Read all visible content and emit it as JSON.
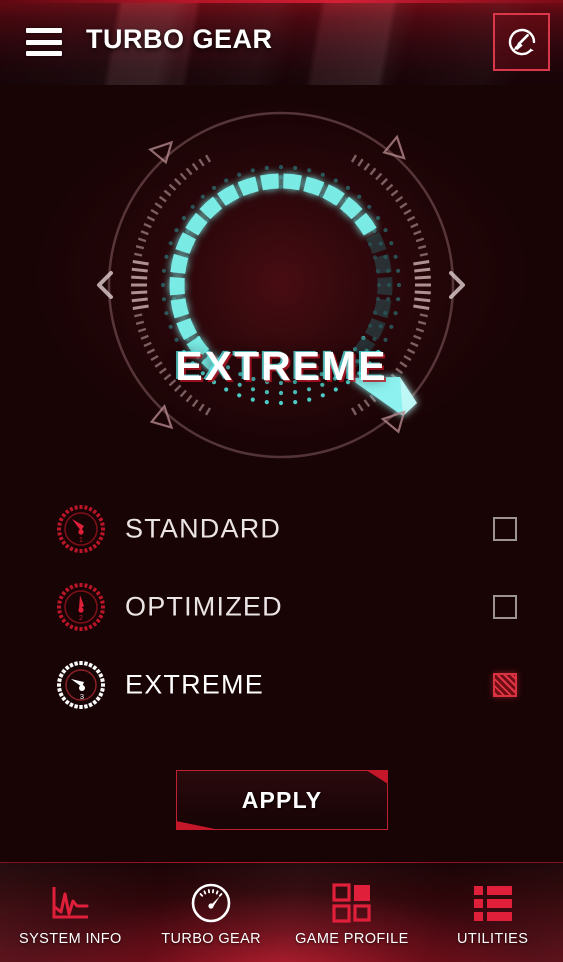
{
  "app": {
    "title": "TURBO GEAR",
    "menu_icon": "hamburger-menu-icon",
    "clean_icon": "broom-clean-icon",
    "background_color": "#190405",
    "accent_color": "#c4172a",
    "highlight_color": "#6ee8e4"
  },
  "gauge": {
    "value_label": "EXTREME",
    "arc_color": "#7df2ec",
    "left_arrow": "chevron-left-icon",
    "right_arrow": "chevron-right-icon",
    "segments_total": 24,
    "segments_filled": 17,
    "needle_position_deg": 215
  },
  "modes": [
    {
      "label": "STANDARD",
      "icon": "gauge-level-1-icon",
      "digit": "1",
      "selected": false,
      "checkbox": "checkbox-unchecked"
    },
    {
      "label": "OPTIMIZED",
      "icon": "gauge-level-2-icon",
      "digit": "2",
      "selected": false,
      "checkbox": "checkbox-unchecked"
    },
    {
      "label": "EXTREME",
      "icon": "gauge-level-3-icon",
      "digit": "3",
      "selected": true,
      "checkbox": "checkbox-checked"
    }
  ],
  "apply": {
    "label": "APPLY"
  },
  "navbar": {
    "items": [
      {
        "label": "SYSTEM INFO",
        "icon": "chart-line-icon",
        "active": false
      },
      {
        "label": "TURBO GEAR",
        "icon": "speedometer-icon",
        "active": true
      },
      {
        "label": "GAME PROFILE",
        "icon": "grid-squares-icon",
        "active": false
      },
      {
        "label": "UTILITIES",
        "icon": "list-bars-icon",
        "active": false
      }
    ]
  }
}
